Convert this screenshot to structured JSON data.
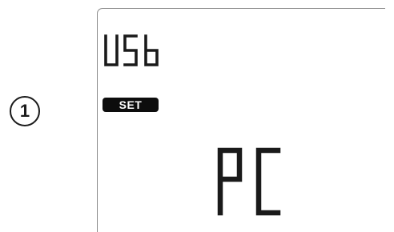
{
  "step": {
    "number": "1"
  },
  "lcd": {
    "mode_text": "USb",
    "set_indicator": "SET",
    "value_text": "PC"
  }
}
